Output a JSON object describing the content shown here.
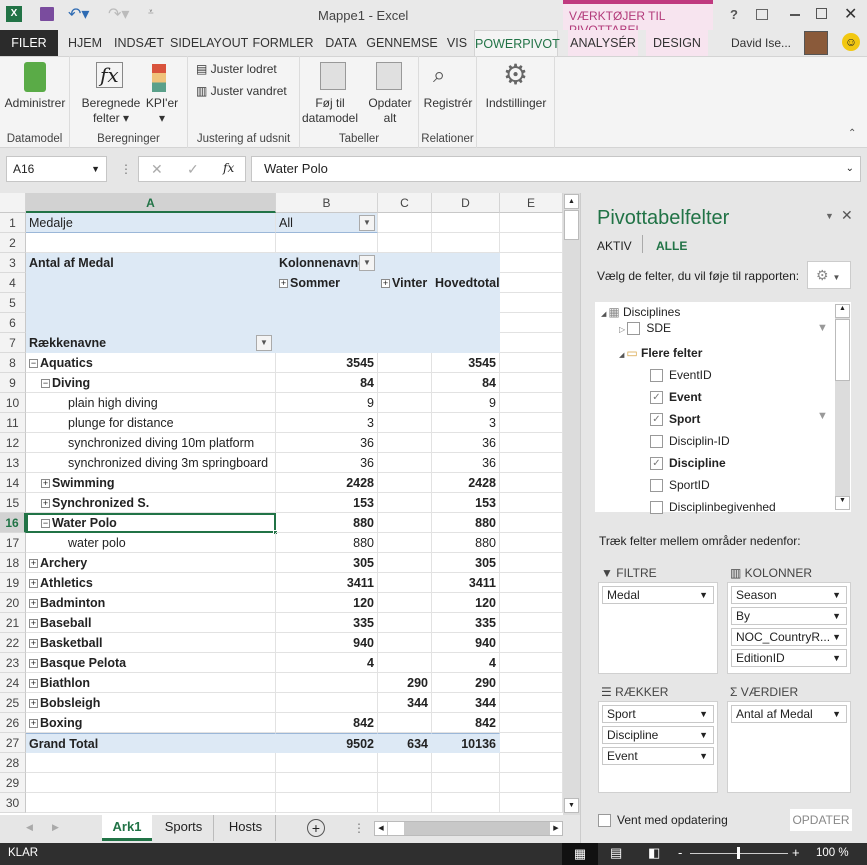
{
  "window": {
    "title": "Mappe1 - Excel",
    "context_title": "VÆRKTØJER TIL PIVOTTABEL",
    "user": "David Ise...",
    "help": "?"
  },
  "tabs": [
    {
      "label": "FILER"
    },
    {
      "label": "HJEM"
    },
    {
      "label": "INDSÆT"
    },
    {
      "label": "SIDELAYOUT"
    },
    {
      "label": "FORMLER"
    },
    {
      "label": "DATA"
    },
    {
      "label": "GENNEMSE"
    },
    {
      "label": "VIS"
    },
    {
      "label": "POWERPIVOT",
      "active": true
    },
    {
      "label": "ANALYSÉR"
    },
    {
      "label": "DESIGN"
    }
  ],
  "ribbon": {
    "groups": [
      "Datamodel",
      "Beregninger",
      "Justering af udsnit",
      "Tabeller",
      "Relationer"
    ],
    "administrer": "Administrer",
    "beregnede1": "Beregnede",
    "beregnede2": "felter",
    "kpi": "KPI'er",
    "juster_lodret": "Juster lodret",
    "juster_vandret": "Juster vandret",
    "foj1": "Føj til",
    "foj2": "datamodel",
    "opd1": "Opdater",
    "opd2": "alt",
    "registrer": "Registrér",
    "indstillinger": "Indstillinger"
  },
  "formula_bar": {
    "name_box": "A16",
    "fx": "fx",
    "value": "Water Polo"
  },
  "columns": [
    "A",
    "B",
    "C",
    "D",
    "E"
  ],
  "filter": {
    "label": "Medalje",
    "value": "All"
  },
  "pivot_header": {
    "values_label": "Antal af Medal",
    "col_labels": "Kolonnenavne",
    "summer": "Sommer",
    "winter": "Vinter",
    "grand": "Hovedtotal",
    "row_labels": "Rækkenavne"
  },
  "rows": [
    {
      "n": 8,
      "label": "Aquatics",
      "lvl": 0,
      "exp": "-",
      "b": "3545",
      "c": "",
      "d": "3545"
    },
    {
      "n": 9,
      "label": "Diving",
      "lvl": 1,
      "exp": "-",
      "b": "84",
      "c": "",
      "d": "84"
    },
    {
      "n": 10,
      "label": "plain high diving",
      "lvl": 2,
      "b": "9",
      "c": "",
      "d": "9"
    },
    {
      "n": 11,
      "label": "plunge for distance",
      "lvl": 2,
      "b": "3",
      "c": "",
      "d": "3"
    },
    {
      "n": 12,
      "label": "synchronized diving 10m platform",
      "lvl": 2,
      "b": "36",
      "c": "",
      "d": "36"
    },
    {
      "n": 13,
      "label": "synchronized diving 3m springboard",
      "lvl": 2,
      "b": "36",
      "c": "",
      "d": "36"
    },
    {
      "n": 14,
      "label": "Swimming",
      "lvl": 1,
      "exp": "+",
      "b": "2428",
      "c": "",
      "d": "2428"
    },
    {
      "n": 15,
      "label": "Synchronized S.",
      "lvl": 1,
      "exp": "+",
      "b": "153",
      "c": "",
      "d": "153"
    },
    {
      "n": 16,
      "label": "Water Polo",
      "lvl": 1,
      "exp": "-",
      "b": "880",
      "c": "",
      "d": "880",
      "selected": true
    },
    {
      "n": 17,
      "label": "water polo",
      "lvl": 2,
      "b": "880",
      "c": "",
      "d": "880"
    },
    {
      "n": 18,
      "label": "Archery",
      "lvl": 0,
      "exp": "+",
      "b": "305",
      "c": "",
      "d": "305"
    },
    {
      "n": 19,
      "label": "Athletics",
      "lvl": 0,
      "exp": "+",
      "b": "3411",
      "c": "",
      "d": "3411"
    },
    {
      "n": 20,
      "label": "Badminton",
      "lvl": 0,
      "exp": "+",
      "b": "120",
      "c": "",
      "d": "120"
    },
    {
      "n": 21,
      "label": "Baseball",
      "lvl": 0,
      "exp": "+",
      "b": "335",
      "c": "",
      "d": "335"
    },
    {
      "n": 22,
      "label": "Basketball",
      "lvl": 0,
      "exp": "+",
      "b": "940",
      "c": "",
      "d": "940"
    },
    {
      "n": 23,
      "label": "Basque Pelota",
      "lvl": 0,
      "exp": "+",
      "b": "4",
      "c": "",
      "d": "4"
    },
    {
      "n": 24,
      "label": "Biathlon",
      "lvl": 0,
      "exp": "+",
      "b": "",
      "c": "290",
      "d": "290"
    },
    {
      "n": 25,
      "label": "Bobsleigh",
      "lvl": 0,
      "exp": "+",
      "b": "",
      "c": "344",
      "d": "344"
    },
    {
      "n": 26,
      "label": "Boxing",
      "lvl": 0,
      "exp": "+",
      "b": "842",
      "c": "",
      "d": "842"
    },
    {
      "n": 27,
      "label": "Grand Total",
      "lvl": 0,
      "b": "9502",
      "c": "634",
      "d": "10136",
      "total": true
    }
  ],
  "sheets": {
    "tabs": [
      "Ark1",
      "Sports",
      "Hosts"
    ],
    "active": "Ark1"
  },
  "status": {
    "text": "KLAR",
    "zoom": "100 %"
  },
  "pane": {
    "title": "Pivottabelfelter",
    "tab_active": "AKTIV",
    "tab_all": "ALLE",
    "choose": "Vælg de felter, du vil føje til rapporten:",
    "fields": [
      {
        "label": "Disciplines",
        "kind": "table"
      },
      {
        "label": "SDE",
        "kind": "field",
        "checked": false,
        "filter": true,
        "collapsed": true
      },
      {
        "label": "Flere felter",
        "kind": "folder"
      },
      {
        "label": "EventID",
        "kind": "sub",
        "checked": false
      },
      {
        "label": "Event",
        "kind": "sub",
        "checked": true
      },
      {
        "label": "Sport",
        "kind": "sub",
        "checked": true,
        "filter": true
      },
      {
        "label": "Disciplin-ID",
        "kind": "sub",
        "checked": false
      },
      {
        "label": "Discipline",
        "kind": "sub",
        "checked": true
      },
      {
        "label": "SportID",
        "kind": "sub",
        "checked": false
      },
      {
        "label": "Disciplinbegivenhed",
        "kind": "sub",
        "checked": false
      }
    ],
    "drag_text": "Træk felter mellem områder nedenfor:",
    "areas": {
      "filters": {
        "label": "FILTRE",
        "items": [
          "Medal"
        ]
      },
      "columns": {
        "label": "KOLONNER",
        "items": [
          "Season",
          "By",
          "NOC_CountryR...",
          "EditionID"
        ]
      },
      "rows": {
        "label": "RÆKKER",
        "items": [
          "Sport",
          "Discipline",
          "Event"
        ]
      },
      "values": {
        "label": "VÆRDIER",
        "items": [
          "Antal af Medal"
        ]
      }
    },
    "defer": "Vent med opdatering",
    "update": "OPDATER"
  },
  "colors": {
    "excel_green": "#217346",
    "context_pink": "#c0397f",
    "pivot_blue": "#dde9f5"
  }
}
